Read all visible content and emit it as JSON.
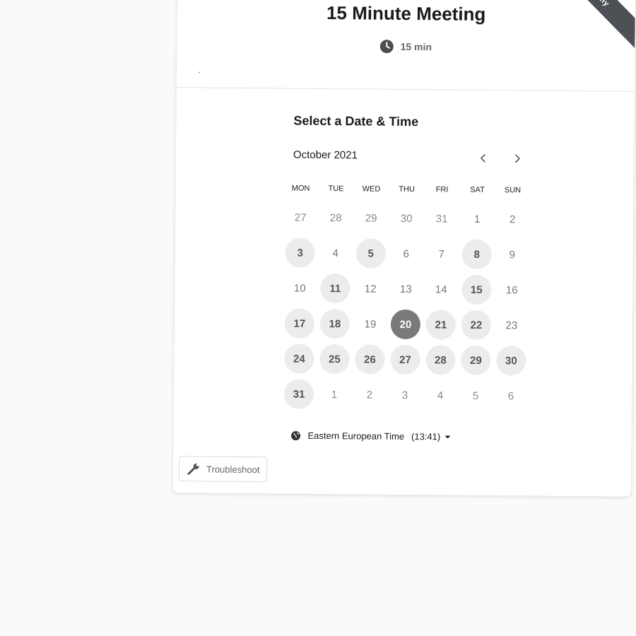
{
  "event": {
    "title": "15 Minute Meeting",
    "duration": "15 min",
    "duration_icon": "clock-icon",
    "ribbon_text": "dly"
  },
  "scheduler": {
    "section_title": "Select a Date & Time",
    "month_label": "October 2021",
    "prev_icon": "chevron-left-icon",
    "next_icon": "chevron-right-icon",
    "weekdays": [
      "MON",
      "TUE",
      "WED",
      "THU",
      "FRI",
      "SAT",
      "SUN"
    ],
    "days": [
      {
        "label": "27",
        "state": "other"
      },
      {
        "label": "28",
        "state": "other"
      },
      {
        "label": "29",
        "state": "other"
      },
      {
        "label": "30",
        "state": "other"
      },
      {
        "label": "31",
        "state": "other"
      },
      {
        "label": "1",
        "state": "unavailable"
      },
      {
        "label": "2",
        "state": "unavailable"
      },
      {
        "label": "3",
        "state": "available"
      },
      {
        "label": "4",
        "state": "unavailable"
      },
      {
        "label": "5",
        "state": "available"
      },
      {
        "label": "6",
        "state": "unavailable"
      },
      {
        "label": "7",
        "state": "unavailable"
      },
      {
        "label": "8",
        "state": "available"
      },
      {
        "label": "9",
        "state": "unavailable"
      },
      {
        "label": "10",
        "state": "unavailable"
      },
      {
        "label": "11",
        "state": "available"
      },
      {
        "label": "12",
        "state": "unavailable"
      },
      {
        "label": "13",
        "state": "unavailable"
      },
      {
        "label": "14",
        "state": "unavailable"
      },
      {
        "label": "15",
        "state": "available"
      },
      {
        "label": "16",
        "state": "unavailable"
      },
      {
        "label": "17",
        "state": "available"
      },
      {
        "label": "18",
        "state": "available"
      },
      {
        "label": "19",
        "state": "unavailable"
      },
      {
        "label": "20",
        "state": "selected"
      },
      {
        "label": "21",
        "state": "available"
      },
      {
        "label": "22",
        "state": "available"
      },
      {
        "label": "23",
        "state": "unavailable"
      },
      {
        "label": "24",
        "state": "available"
      },
      {
        "label": "25",
        "state": "available"
      },
      {
        "label": "26",
        "state": "available"
      },
      {
        "label": "27",
        "state": "available"
      },
      {
        "label": "28",
        "state": "available"
      },
      {
        "label": "29",
        "state": "available"
      },
      {
        "label": "30",
        "state": "available"
      },
      {
        "label": "31",
        "state": "available"
      },
      {
        "label": "1",
        "state": "other"
      },
      {
        "label": "2",
        "state": "other"
      },
      {
        "label": "3",
        "state": "other"
      },
      {
        "label": "4",
        "state": "other"
      },
      {
        "label": "5",
        "state": "other"
      },
      {
        "label": "6",
        "state": "other"
      }
    ],
    "timezone": {
      "label": "Eastern European Time",
      "time": "(13:41)",
      "icon": "globe-icon"
    }
  },
  "troubleshoot": {
    "label": "Troubleshoot",
    "icon": "wrench-icon"
  },
  "colors": {
    "page_bg": "#fafafa",
    "card_bg": "#ffffff",
    "available_bg": "#ececec",
    "selected_bg": "#7a7a7a",
    "ribbon_bg": "#4d5055"
  }
}
